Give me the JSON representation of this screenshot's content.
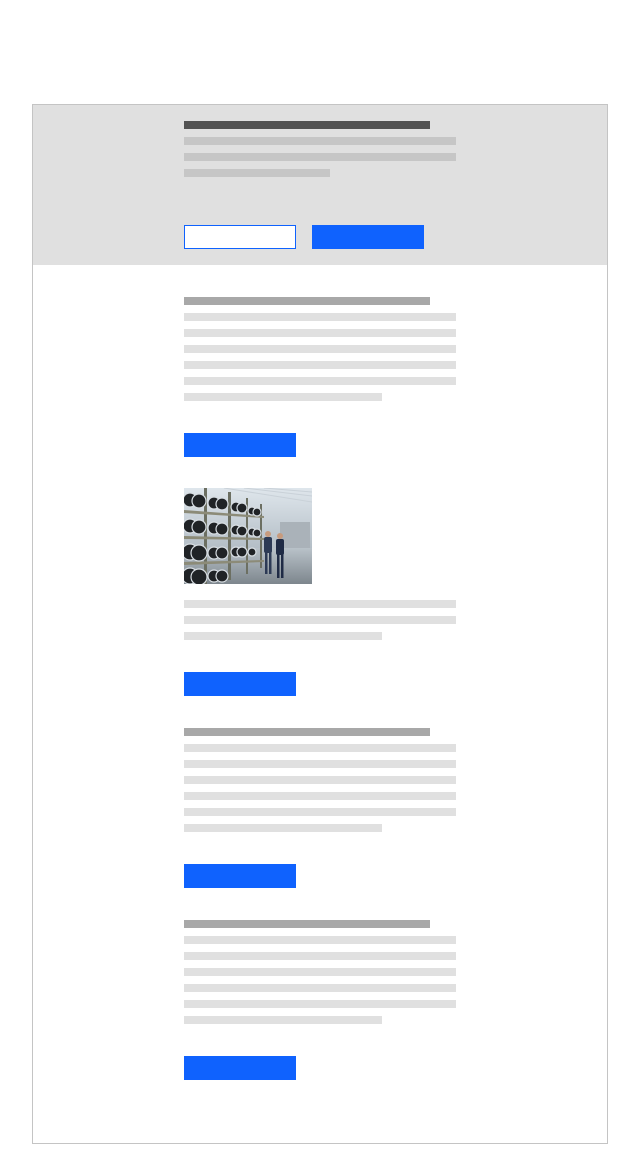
{
  "page": {
    "hero": {
      "secondary_button": {
        "label": ""
      },
      "primary_button": {
        "label": ""
      }
    },
    "sections": [
      {
        "button_label": ""
      },
      {
        "image_alt": "",
        "button_label": ""
      },
      {
        "button_label": ""
      },
      {
        "button_label": ""
      }
    ]
  },
  "colors": {
    "primary": "#0f62fe",
    "hero_background": "#e0e0e0",
    "frame_border": "#c4c4c4",
    "heading_placeholder": "#a8a8a8",
    "text_placeholder": "#e0e0e0"
  },
  "icons": []
}
